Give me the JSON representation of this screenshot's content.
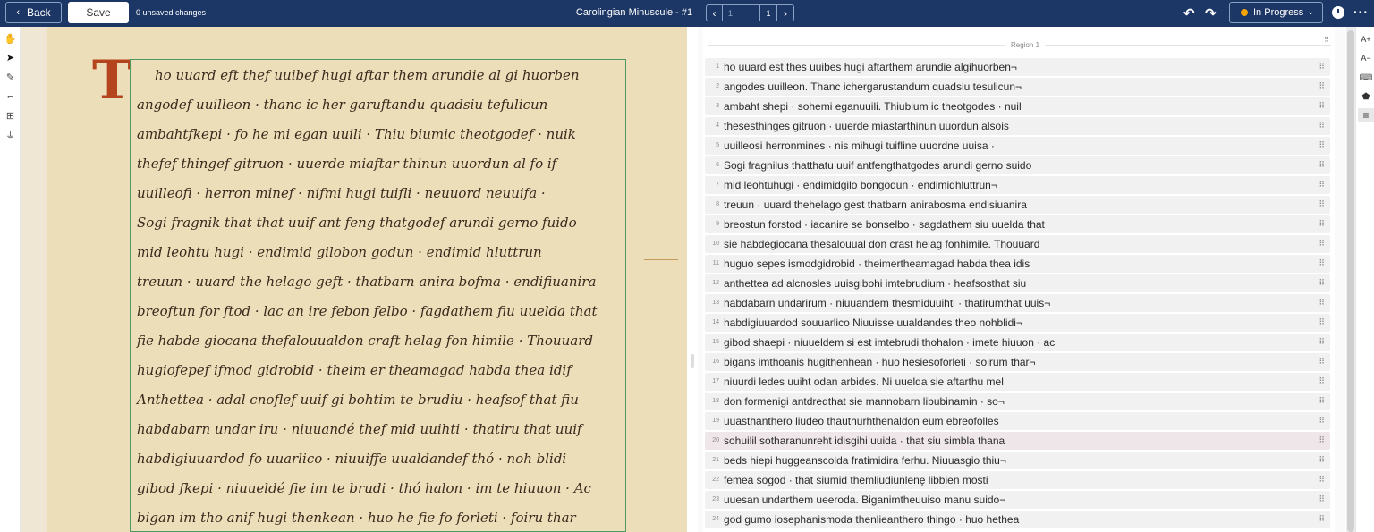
{
  "header": {
    "back_label": "Back",
    "save_label": "Save",
    "unsaved_text": "0 unsaved changes",
    "document_title": "Carolingian Minuscule - #1",
    "page_input_placeholder": "1",
    "page_total": "1",
    "status_label": "In Progress",
    "status_color": "#f5a400"
  },
  "left_tools": [
    "hand-icon",
    "pointer-icon",
    "pen-icon",
    "crop-icon",
    "layout-icon",
    "baseline-icon"
  ],
  "right_tools": {
    "font_increase": "A+",
    "font_decrease": "A−",
    "icons": [
      "keyboard-icon",
      "tag-icon",
      "list-icon"
    ]
  },
  "transcription": {
    "region_label": "Region 1",
    "highlighted_line": 20,
    "lines": [
      "ho uuard est thes uuibes hugi aftarthem arundie algihuorben¬",
      "angodes uuilleon. Thanc ichergarustandum quadsiu tesulicun¬",
      "ambaht shepi · sohemi eganuuili. Thiubium ic theotgodes · nuil",
      "thesesthinges gitruon · uuerde miastarthinun uuordun alsois",
      "uuilleosi herronmines · nis mihugi tuifline uuordne uuisa ·",
      "Sogi fragnilus thatthatu uuif antfengthatgodes arundi gerno suido",
      "mid leohtuhugi · endimidgilo bongodun · endimidhluttrun¬",
      "treuun · uuard thehelago gest thatbarn anirabosma endisiuanira",
      "breostun forstod · iacanire se bonselbo · sagdathem siu uuelda that",
      "sie habdegiocana thesalouual don crast helag fonhimile. Thouuard",
      "huguo sepes ismodgidrobid · theimertheamagad habda thea idis",
      "anthettea ad alcnosles uuisgibohi imtebrudium · heafsosthat siu",
      "habdabarn undarirum · niuuandem thesmiduuihti · thatirumthat uuis¬",
      "habdigiuuardod souuarlico Niuuisse uualdandes theo nohblidi¬",
      "gibod shaepi · niuueldem si est imtebrudi thohalon · imete hiuuon · ac",
      "bigans imthoanis hugithenhean · huo hesiesoforleti · soirum thar¬",
      "niuurdi ledes uuiht odan arbides. Ni uuelda sie aftarthu mel",
      "don formenigi antdredthat sie mannobarn libubinamin · so¬",
      "uuasthanthero liudeo thauthurhthenaldon eum ebreofolles",
      "sohuilil sotharanunreht idisgihi uuida · that siu simbla thana",
      "beds hiepi huggeanscolda fratimidira ferhu. Niuuasgio thiu¬",
      "femea sogod · that siumid themliudiunlenę libbien mosti",
      "uuesan undarthem ueeroda. Biganimtheuuiso manu suido¬",
      "god gumo iosephanismoda thenlieanthero thingo · huo hethea"
    ]
  },
  "manuscript": {
    "lines": [
      "ho uuard eft thef uuibef hugi aftar them arundie al gi huorben",
      "angodef uuilleon · thanc ic her garuftandu quadsiu tefulicun",
      "ambahtfkepi · fo he mi egan uuili · Thiu biumic theotgodef · nuik",
      "thefef thingef gitruon · uuerde miaftar thinun uuordun al fo if",
      "uuilleofi · herron minef · nifmi hugi tuifli · neuuord neuuifa ·",
      "Sogi fragnik that that uuif ant feng thatgodef arundi gerno fuido",
      "mid leohtu hugi · endimid gilobon godun · endimid hluttrun",
      "treuun · uuard the helago geft · thatbarn anira bofma · endifiuanira",
      "breoftun for ftod · lac an ire febon felbo · fagdathem fiu uuelda that",
      "fie habde giocana thefalouualdon craft helag fon himile · Thouuard",
      "hugiofepef ifmod gidrobid · theim er theamagad habda thea idif",
      "Anthettea · adal cnoflef uuif gi bohtim te brudiu · heafsof that fiu",
      "habdabarn undar iru · niuuandé thef mid uuihti · thatiru that uuif",
      "habdigiuuardod fo uuarlico · niuuiffe uualdandef thó · noh blidi",
      "gibod fkepi · niuueldé fie im te brudi · thó halon · im te hiuuon · Ac",
      "bigan im tho anif hugi thenkean · huo he fie fo forleti · foiru thar"
    ]
  }
}
